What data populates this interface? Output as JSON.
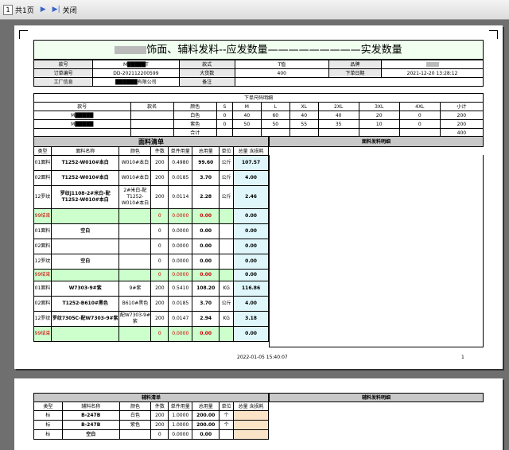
{
  "toolbar": {
    "page_of": "共1页",
    "close": "关闭"
  },
  "header": {
    "title_main": "饰面、辅料发料--应发数量—————————实发数量",
    "row1": [
      "款号",
      "M█████T",
      "款式",
      "T恤",
      "品牌",
      ""
    ],
    "row2": [
      "订单编号",
      "DD-202112200599",
      "大货数",
      "400",
      "下单日期",
      "2021-12-20 13:28:12"
    ],
    "row3": [
      "工厂信息",
      "██████有限公司",
      "备注",
      ""
    ]
  },
  "size_table": {
    "caption": "下单尺码明细",
    "cols": [
      "款号",
      "款名",
      "颜色",
      "S",
      "M",
      "L",
      "XL",
      "2XL",
      "3XL",
      "4XL",
      "小计"
    ],
    "rows": [
      [
        "M█████",
        "",
        "白色",
        "0",
        "40",
        "60",
        "40",
        "40",
        "20",
        "0",
        "200"
      ],
      [
        "M█████",
        "",
        "紫色",
        "0",
        "50",
        "50",
        "55",
        "35",
        "10",
        "0",
        "200"
      ],
      [
        "",
        "",
        "合计",
        "",
        "",
        "",
        "",
        "",
        "",
        "",
        "400"
      ]
    ]
  },
  "fabric": {
    "caption": "面料清单",
    "detail_caption": "面料发料明细",
    "cols": [
      "类型",
      "面料名称",
      "颜色",
      "件数",
      "单件用量",
      "总用量",
      "单位",
      "总量 含损耗"
    ],
    "rows": [
      [
        "01面料",
        "T1252-W010#本白",
        "W010#本白",
        "200",
        "0.4980",
        "99.60",
        "公斤",
        "107.57"
      ],
      [
        "02面料",
        "T1252-W010#本白",
        "W010#本白",
        "200",
        "0.0185",
        "3.70",
        "公斤",
        "4.00"
      ],
      [
        "12罗纹",
        "罗纹j1108-2#米白-配T1252-W010#本白",
        "2#米白-配T1252-W010#本白",
        "200",
        "0.0114",
        "2.28",
        "公斤",
        "2.46"
      ],
      [
        "99结束",
        "",
        "",
        "0",
        "0.0000",
        "0.00",
        "",
        "0.00"
      ],
      [
        "01面料",
        "空白",
        "",
        "0",
        "0.0000",
        "0.00",
        "",
        "0.00"
      ],
      [
        "02面料",
        "",
        "",
        "0",
        "0.0000",
        "0.00",
        "",
        "0.00"
      ],
      [
        "12罗纹",
        "空白",
        "",
        "0",
        "0.0000",
        "0.00",
        "",
        "0.00"
      ],
      [
        "99结束",
        "",
        "",
        "0",
        "0.0000",
        "0.00",
        "",
        "0.00"
      ],
      [
        "01面料",
        "W7303-9#紫",
        "9#紫",
        "200",
        "0.5410",
        "108.20",
        "KG",
        "116.86"
      ],
      [
        "02面料",
        "T1252-B610#黑色",
        "B610#黑色",
        "200",
        "0.0185",
        "3.70",
        "公斤",
        "4.00"
      ],
      [
        "12罗纹",
        "罗纹7305C-配W7303-9#紫",
        "配W7303-9#紫",
        "200",
        "0.0147",
        "2.94",
        "KG",
        "3.18"
      ],
      [
        "99结束",
        "",
        "",
        "0",
        "0.0000",
        "0.00",
        "",
        "0.00"
      ]
    ]
  },
  "footer": {
    "datetime": "2022-01-05 15:40:07",
    "page": "1"
  },
  "accessory": {
    "caption": "辅料清单",
    "detail_caption": "辅料发料明细",
    "cols": [
      "类型",
      "辅料名称",
      "颜色",
      "件数",
      "单件用量",
      "总用量",
      "单位",
      "总量 含损耗"
    ],
    "rows": [
      [
        "标",
        "B-247B",
        "白色",
        "200",
        "1.0000",
        "200.00",
        "个",
        ""
      ],
      [
        "标",
        "B-247B",
        "紫色",
        "200",
        "1.0000",
        "200.00",
        "个",
        ""
      ],
      [
        "标",
        "空白",
        "",
        "0",
        "0.0000",
        "0.00",
        "",
        ""
      ]
    ]
  }
}
